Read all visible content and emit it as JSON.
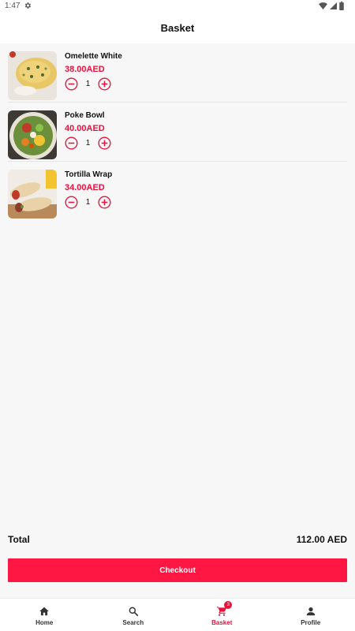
{
  "status_bar": {
    "time": "1:47",
    "icons": [
      "gear-icon",
      "wifi-icon",
      "signal-icon",
      "battery-icon"
    ]
  },
  "header": {
    "title": "Basket"
  },
  "basket": {
    "items": [
      {
        "name": "Omelette White",
        "price": "38.00AED",
        "quantity": "1",
        "image": "omelette-image"
      },
      {
        "name": "Poke Bowl",
        "price": "40.00AED",
        "quantity": "1",
        "image": "poke-bowl-image"
      },
      {
        "name": "Tortilla Wrap",
        "price": "34.00AED",
        "quantity": "1",
        "image": "tortilla-wrap-image"
      }
    ]
  },
  "summary": {
    "total_label": "Total",
    "total_value": "112.00 AED"
  },
  "checkout": {
    "label": "Checkout"
  },
  "bottom_nav": {
    "items": [
      {
        "label": "Home",
        "icon": "home-icon"
      },
      {
        "label": "Search",
        "icon": "search-icon"
      },
      {
        "label": "Basket",
        "icon": "cart-icon",
        "badge": "3"
      },
      {
        "label": "Profile",
        "icon": "person-icon"
      }
    ],
    "active": "Basket"
  },
  "colors": {
    "accent": "#e8123f",
    "checkout_button": "#ff1744",
    "background": "#f7f7f7"
  }
}
